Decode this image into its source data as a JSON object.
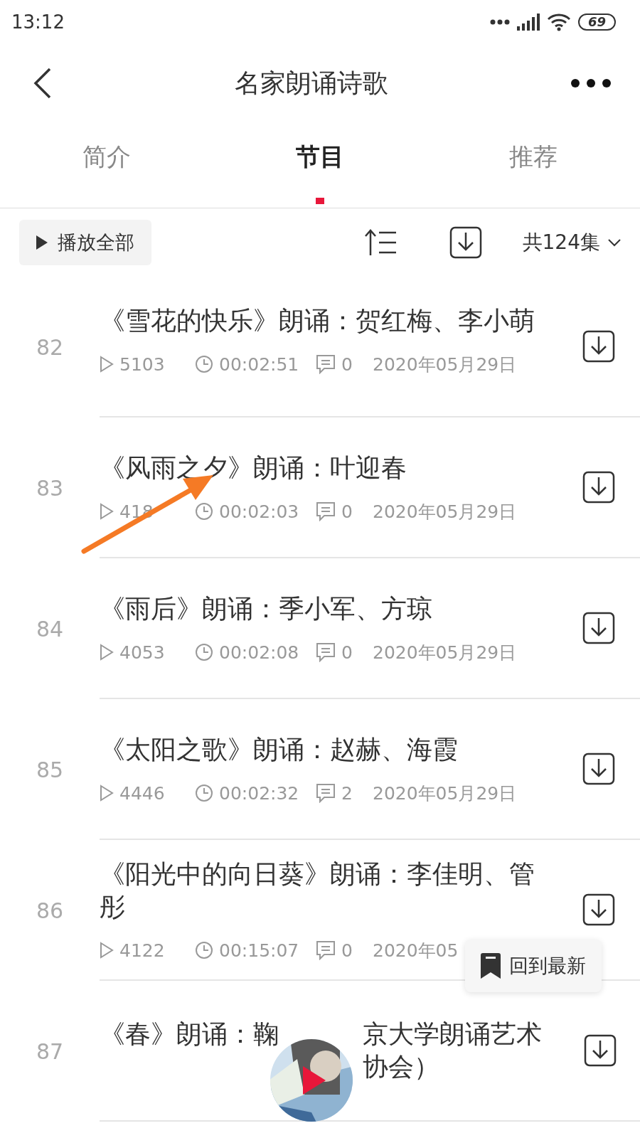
{
  "status_bar": {
    "time": "13:12",
    "battery": "69"
  },
  "header": {
    "title": "名家朗诵诗歌"
  },
  "tabs": [
    {
      "label": "简介",
      "selected": false
    },
    {
      "label": "节目",
      "selected": true
    },
    {
      "label": "推荐",
      "selected": false
    }
  ],
  "toolbar": {
    "play_all": "播放全部",
    "episode_count": "共124集"
  },
  "episodes": [
    {
      "number": "82",
      "title": "《雪花的快乐》朗诵：贺红梅、李小萌",
      "plays": "5103",
      "duration": "00:02:51",
      "comments": "0",
      "date": "2020年05月29日"
    },
    {
      "number": "83",
      "title": "《风雨之夕》朗诵：叶迎春",
      "plays": "418",
      "duration": "00:02:03",
      "comments": "0",
      "date": "2020年05月29日"
    },
    {
      "number": "84",
      "title": "《雨后》朗诵：季小军、方琼",
      "plays": "4053",
      "duration": "00:02:08",
      "comments": "0",
      "date": "2020年05月29日"
    },
    {
      "number": "85",
      "title": "《太阳之歌》朗诵：赵赫、海霞",
      "plays": "4446",
      "duration": "00:02:32",
      "comments": "2",
      "date": "2020年05月29日"
    },
    {
      "number": "86",
      "title": "《阳光中的向日葵》朗诵：李佳明、管彤",
      "plays": "4122",
      "duration": "00:15:07",
      "comments": "0",
      "date": "2020年05"
    },
    {
      "number": "87",
      "title_parts": [
        "《春》朗诵：鞠",
        "京大学朗诵艺术协会）"
      ]
    }
  ],
  "back_to_latest": "回到最新"
}
